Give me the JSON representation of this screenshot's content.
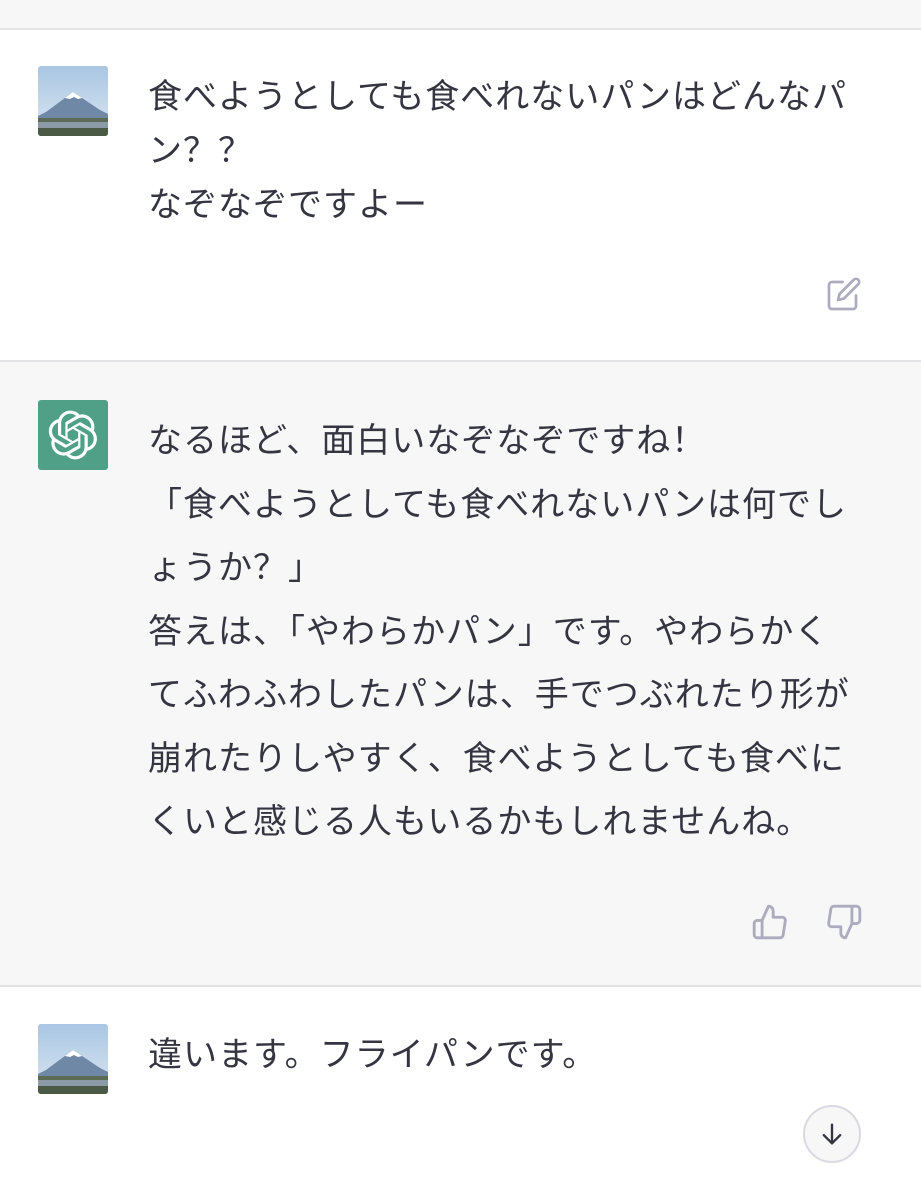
{
  "conversation": {
    "messages": [
      {
        "role": "user",
        "avatar": "mount-fuji-photo-avatar",
        "text": "食べようとしても食べれないパンはどんなパ\nン？？\nなぞなぞですよー",
        "action_icon": "edit-icon"
      },
      {
        "role": "assistant",
        "avatar": "chatgpt-logo-icon",
        "text": "なるほど、面白いなぞなぞですね！\n「食べようとしても食べれないパンは何でし\nょうか？」\n答えは、「やわらかパン」です。やわらかく\nてふわふわしたパンは、手でつぶれたり形が\n崩れたりしやすく、食べようとしても食べに\nくいと感じる人もいるかもしれませんね。",
        "action_icons": [
          "thumbs-up-icon",
          "thumbs-down-icon"
        ]
      },
      {
        "role": "user",
        "avatar": "mount-fuji-photo-avatar",
        "text": "違います。フライパンです。"
      }
    ],
    "scroll_button_icon": "arrow-down-icon"
  },
  "colors": {
    "assistant_avatar_bg": "#4fa086",
    "assistant_row_bg": "#f7f7f8",
    "text": "#343541",
    "icon": "#acacbe"
  }
}
